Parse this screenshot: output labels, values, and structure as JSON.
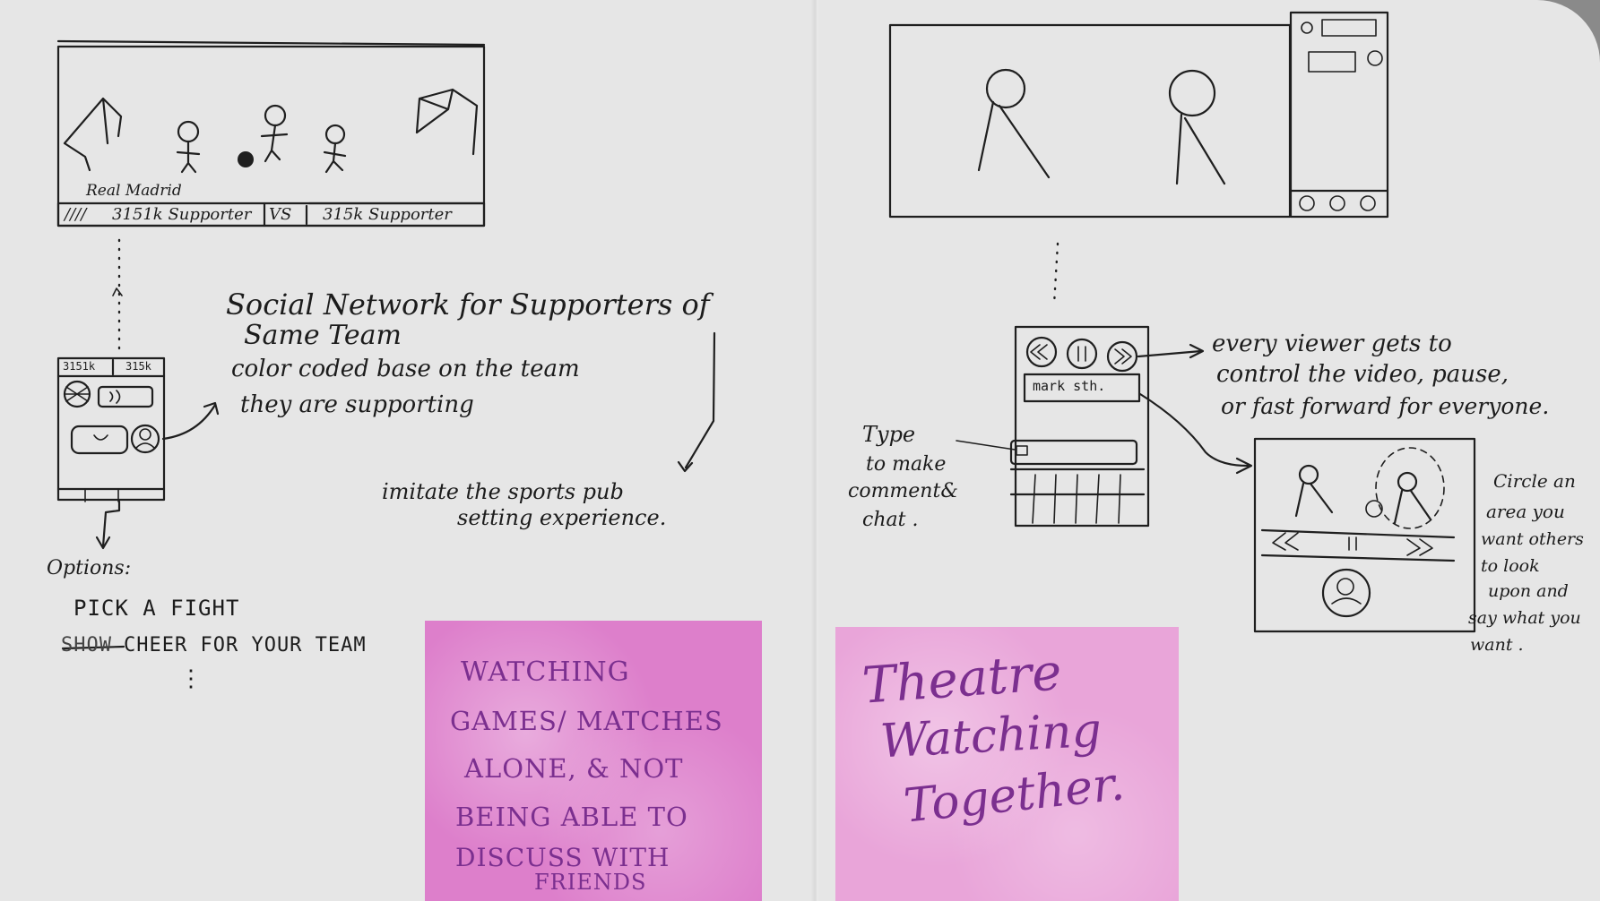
{
  "colors": {
    "paper": "#e6e6e6",
    "ink": "#1f1f1f",
    "sticky_left": "#dd7fcb",
    "sticky_right": "#e9a5d9",
    "sticky_ink": "#7b2f8f"
  },
  "left_page": {
    "stadium_sketch": {
      "team_label": "Real Madrid",
      "score_bar": {
        "left_marks": "////",
        "left_supporters": "3151k Supporter",
        "versus": "VS",
        "right_supporters": "315k Supporter"
      }
    },
    "phone_sketch": {
      "left_count": "3151k",
      "right_count": "315k"
    },
    "concept_title": "Social Network for Supporters of Same Team",
    "concept_title_lines": [
      "Social  Network  for  Supporters  of",
      "Same  Team"
    ],
    "concept_desc_lines": [
      "color  coded  base  on  the  team",
      "they   are   supporting"
    ],
    "imitate_lines": [
      "imitate  the  sports  pub",
      "setting  experience."
    ],
    "options_label": "Options:",
    "options": [
      "PICK A FIGHT",
      "CHEER FOR YOUR TEAM"
    ],
    "options_struck": "SHOW",
    "options_more": "⋮",
    "sticky_note": {
      "lines": [
        "WATCHING",
        "GAMES/ MATCHES",
        "ALONE, & NOT",
        "BEING ABLE TO",
        "DISCUSS WITH",
        "FRIENDS"
      ]
    }
  },
  "right_page": {
    "controls_note_lines": [
      "every  viewer  gets  to",
      "control  the  video,  pause,",
      "or  fast forward  for  everyone."
    ],
    "controls_struck": "to",
    "mark_button_label": "mark sth.",
    "type_note_lines": [
      "Type",
      "to make",
      "comment&",
      "chat ."
    ],
    "circle_note_lines": [
      "Circle an",
      "area you",
      "want others",
      "to look",
      "upon and",
      "say what you",
      "want ."
    ],
    "sticky_note": {
      "lines": [
        "Theatre",
        "Watching",
        "Together."
      ]
    }
  }
}
